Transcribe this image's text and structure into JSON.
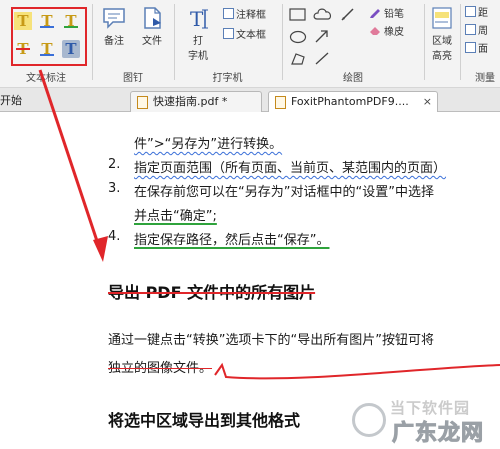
{
  "ribbon": {
    "groups": {
      "text_markup": "文本标注",
      "pin": "图钉",
      "typewriter": "打字机",
      "drawing": "绘图",
      "measure": "测量"
    },
    "buttons": {
      "note": "备注",
      "file": "文件",
      "typewriter_line1": "打",
      "typewriter_line2": "字机",
      "callout": "注释框",
      "textbox": "文本框",
      "pencil": "铅笔",
      "eraser": "橡皮",
      "area_line1": "区域",
      "area_line2": "高亮",
      "measure_1": "距",
      "measure_2": "周",
      "measure_3": "面"
    },
    "markup_glyph": "T",
    "colors": {
      "highlight_box": "#e0262a",
      "markup_glyph": "#c79a16",
      "selected_tool": "#a8b8cf"
    }
  },
  "tabs": [
    {
      "label": "开始"
    },
    {
      "label": "快速指南.pdf *"
    },
    {
      "label": "FoxitPhantomPDF9....",
      "close": "×"
    }
  ],
  "document": {
    "list": [
      {
        "num": "",
        "text": "件”>“另存为”进行转换。"
      },
      {
        "num": "2.",
        "text": "指定页面范围（所有页面、当前页、某范围内的页面）"
      },
      {
        "num": "3.",
        "text": "在保存前您可以在“另存为”对话框中的“设置”中选择"
      },
      {
        "num": "",
        "text": "并点击“确定”;"
      },
      {
        "num": "4.",
        "text": "指定保存路径，然后点击“保存”。"
      }
    ],
    "heading1": "导出 PDF 文件中的所有图片",
    "paragraph_line1": "通过一键点击“转换”选项卡下的“导出所有图片”按钮可将",
    "paragraph_line2": "独立的图像文件。",
    "heading2": "将选中区域导出到其他格式"
  },
  "watermark": {
    "line1": "当下软件园",
    "line2": "广东龙网"
  }
}
